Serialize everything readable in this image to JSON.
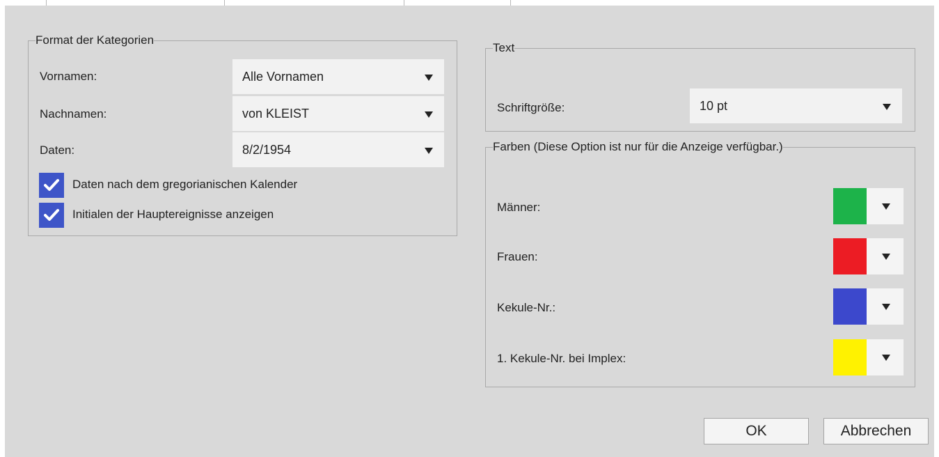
{
  "format_group": {
    "legend": "Format der Kategorien",
    "fields": [
      {
        "label": "Vornamen:",
        "value": "Alle Vornamen"
      },
      {
        "label": "Nachnamen:",
        "value": "von KLEIST"
      },
      {
        "label": "Daten:",
        "value": "8/2/1954"
      }
    ],
    "checkboxes": [
      {
        "label": "Daten nach dem gregorianischen Kalender",
        "checked": true
      },
      {
        "label": "Initialen der Hauptereignisse anzeigen",
        "checked": true
      }
    ]
  },
  "text_group": {
    "legend": "Text",
    "font_size_label": "Schriftgröße:",
    "font_size_value": "10 pt"
  },
  "colors_group": {
    "legend": "Farben (Diese Option ist nur für die Anzeige verfügbar.)",
    "items": [
      {
        "label": "Männer:",
        "color": "#1db34a"
      },
      {
        "label": "Frauen:",
        "color": "#ec1c24"
      },
      {
        "label": "Kekule-Nr.:",
        "color": "#3c48cc"
      },
      {
        "label": "1. Kekule-Nr. bei Implex:",
        "color": "#fff200"
      }
    ]
  },
  "buttons": {
    "ok": "OK",
    "cancel": "Abbrechen"
  },
  "accent_color": "#3e55c8"
}
